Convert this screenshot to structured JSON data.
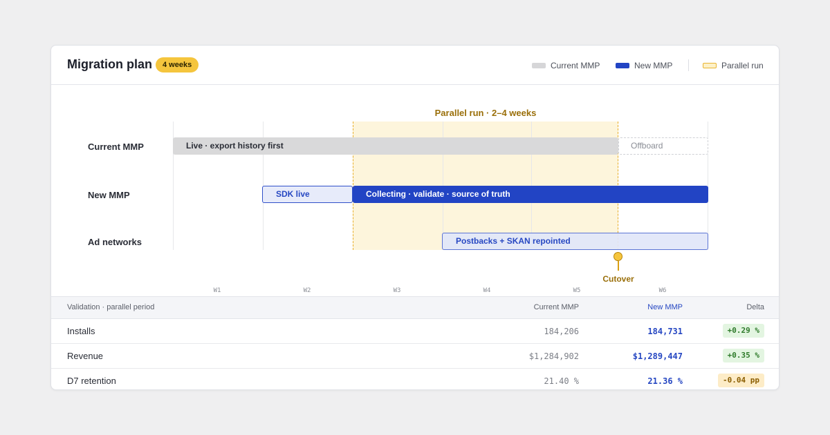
{
  "header": {
    "title": "Migration plan",
    "duration_badge": "4 weeks",
    "legend": [
      {
        "label": "Current MMP",
        "color": "#d6d6d8"
      },
      {
        "label": "New MMP",
        "color": "#2244c4"
      },
      {
        "label": "Parallel run",
        "color": "#fdf1c8"
      }
    ]
  },
  "timeline": {
    "phase_label": "Parallel run · 2–4 weeks",
    "rows": [
      {
        "label": "Current MMP"
      },
      {
        "label": "New MMP"
      },
      {
        "label": "Ad networks"
      }
    ],
    "bars": {
      "current_live": "Live · export history first",
      "current_offboard": "Offboard",
      "new_sdk": "SDK live",
      "new_collecting": "Collecting · validate · source of truth",
      "ad_postbacks": "Postbacks + SKAN repointed"
    },
    "cutover_label": "Cutover",
    "weeks": [
      "W1",
      "W2",
      "W3",
      "W4",
      "W5",
      "W6"
    ]
  },
  "validation": {
    "headers": {
      "label": "Validation · parallel period",
      "current": "Current MMP",
      "new": "New MMP",
      "delta": "Delta"
    },
    "rows": [
      {
        "metric": "Installs",
        "current": "184,206",
        "new": "184,731",
        "delta": "+0.29 %",
        "delta_status": "positive"
      },
      {
        "metric": "Revenue",
        "current": "$1,284,902",
        "new": "$1,289,447",
        "delta": "+0.35 %",
        "delta_status": "positive"
      },
      {
        "metric": "D7 retention",
        "current": "21.40 %",
        "new": "21.36 %",
        "delta": "-0.04 pp",
        "delta_status": "warning"
      }
    ]
  }
}
